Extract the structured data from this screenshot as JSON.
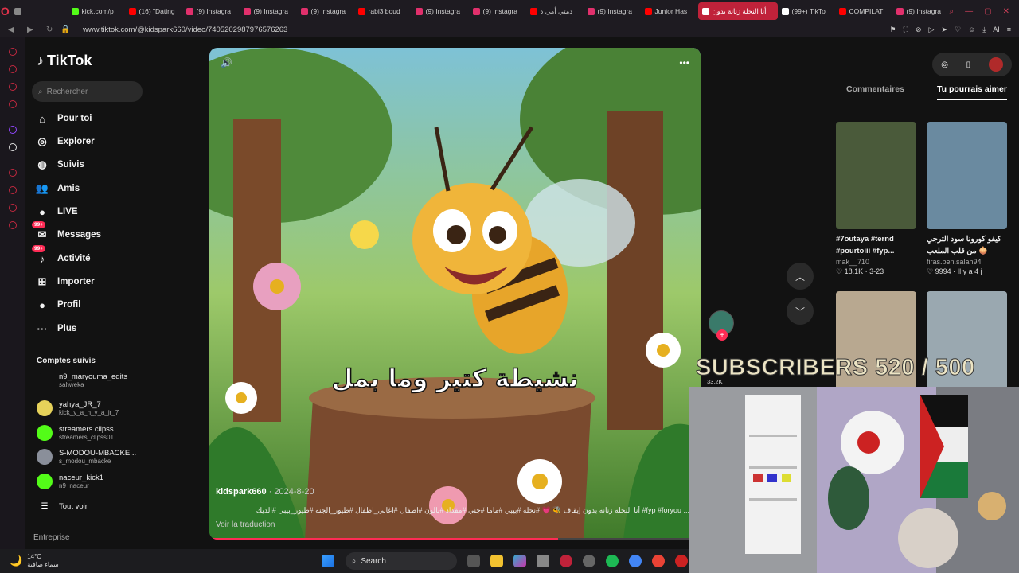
{
  "tabs": [
    {
      "label": "",
      "color": "#888"
    },
    {
      "label": "kick.com/p",
      "color": "#53fc18"
    },
    {
      "label": "(16) \"Dating",
      "color": "#ff0000"
    },
    {
      "label": "(9) Instagra",
      "color": "#e1306c"
    },
    {
      "label": "(9) Instagra",
      "color": "#e1306c"
    },
    {
      "label": "(9) Instagra",
      "color": "#e1306c"
    },
    {
      "label": "rabi3 boud",
      "color": "#ff0000"
    },
    {
      "label": "(9) Instagra",
      "color": "#e1306c"
    },
    {
      "label": "(9) Instagra",
      "color": "#e1306c"
    },
    {
      "label": "دمتي أمي د",
      "color": "#ff0000"
    },
    {
      "label": "(9) Instagra",
      "color": "#e1306c"
    },
    {
      "label": "Junior Has",
      "color": "#ff0000"
    },
    {
      "label": "أنا النحلة زنانة بدون",
      "color": "#ffffff",
      "active": true
    },
    {
      "label": "(99+) TikTo",
      "color": "#ffffff"
    },
    {
      "label": "COMPILAT",
      "color": "#ff0000"
    },
    {
      "label": "(9) Instagra",
      "color": "#e1306c"
    }
  ],
  "address": {
    "url": "www.tiktok.com/@kidspark660/video/7405202987976576263",
    "ai_label": "AI"
  },
  "sidebar": {
    "logo": "TikTok",
    "search_placeholder": "Rechercher",
    "nav": [
      {
        "label": "Pour toi",
        "icon": "home-icon",
        "glyph": "⌂"
      },
      {
        "label": "Explorer",
        "icon": "compass-icon",
        "glyph": "◎"
      },
      {
        "label": "Suivis",
        "icon": "following-icon",
        "glyph": "◍"
      },
      {
        "label": "Amis",
        "icon": "friends-icon",
        "glyph": "👥"
      },
      {
        "label": "LIVE",
        "icon": "live-icon",
        "glyph": "●"
      },
      {
        "label": "Messages",
        "icon": "messages-icon",
        "glyph": "✉",
        "badge": "99+"
      },
      {
        "label": "Activité",
        "icon": "activity-icon",
        "glyph": "♪",
        "badge": "99+"
      },
      {
        "label": "Importer",
        "icon": "upload-icon",
        "glyph": "⊞"
      },
      {
        "label": "Profil",
        "icon": "profile-icon",
        "glyph": "●"
      },
      {
        "label": "Plus",
        "icon": "more-icon",
        "glyph": "···"
      }
    ],
    "followed_title": "Comptes suivis",
    "followed": [
      {
        "name": "n9_maryouma_edits",
        "handle": "sahweka",
        "color": "#121212"
      },
      {
        "name": "yahya_JR_7",
        "handle": "kick_y_a_h_y_a_jr_7",
        "color": "#e6d25a"
      },
      {
        "name": "streamers clipss",
        "handle": "streamers_clipss01",
        "color": "#53fc18"
      },
      {
        "name": "S-MODOU-MBACKE...",
        "handle": "s_modou_mbacke",
        "color": "#8a8f9a"
      },
      {
        "name": "naceur_kick1",
        "handle": "n9_naceur",
        "color": "#53fc18"
      }
    ],
    "see_all": "Tout voir",
    "footer": "Entreprise"
  },
  "video": {
    "caption_overlay": "نشيطة كتير وما بمل",
    "author": "kidspark660",
    "date": "2024-8-20",
    "description": "أنا النحلة زنانة بدون إيقاف 🐝 💗 #نحلة #بيبي #ماما #جني #مقداد #بالون #اطفال #اغاني_اطفال #طيور_الجنة #طيور_بيبي #الديك #fyp #foryou ...",
    "more": "plus",
    "translate": "Voir la traduction",
    "progress": 0.71
  },
  "actions": {
    "like_count": "33.2K"
  },
  "right_panel": {
    "tab_comments": "Commentaires",
    "tab_suggest": "Tu pourrais aimer",
    "cards": [
      {
        "title": "#7outaya #ternd #pourtoiii #fyp...",
        "user": "mak__710",
        "stats": "♡ 18.1K · 3-23",
        "color": "#4a5a3a"
      },
      {
        "title": "كيفو كورونا سود الترجي من قلب الملعب 🧅",
        "user": "firas.ben.salah94",
        "stats": "♡ 9994 · Il y a 4 j",
        "color": "#6a8aa0"
      },
      {
        "title": "",
        "user": "",
        "stats": "",
        "color": "#b8a890"
      },
      {
        "title": "",
        "user": "",
        "stats": "",
        "color": "#9aa8b0"
      }
    ]
  },
  "overlay": {
    "subscribers": "SUBSCRIBERS 520 / 500"
  },
  "taskbar": {
    "temp": "14°C",
    "weather": "سماء صافية",
    "search": "Search"
  }
}
